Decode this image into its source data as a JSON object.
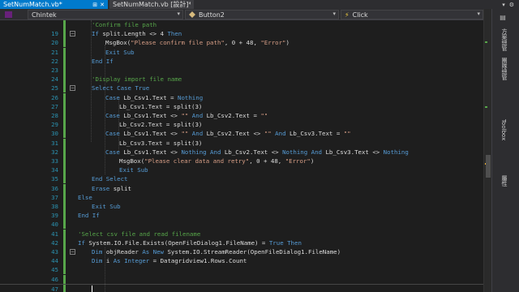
{
  "tabs": [
    {
      "label": "SetNumMatch.vb*",
      "pin": "⊞",
      "close": "✕",
      "active": true
    },
    {
      "label": "SetNumMatch.vb [設計]*",
      "active": false
    }
  ],
  "window_tools": [
    "▾",
    "⚙"
  ],
  "nav": {
    "project": "Chintek",
    "object": "Button2",
    "event": "Click"
  },
  "side_panel": {
    "tabs": [
      "方案總管",
      "團隊總管",
      "Toolbox",
      "屬性"
    ]
  },
  "code_lines": [
    {
      "n": "",
      "indent": 3,
      "parts": [
        [
          "c",
          "'Confirm file path"
        ]
      ]
    },
    {
      "n": "19",
      "indent": 3,
      "parts": [
        [
          "k",
          "If "
        ],
        [
          "t",
          "split.Length <> 4 "
        ],
        [
          "k",
          "Then"
        ]
      ]
    },
    {
      "n": "20",
      "indent": 4,
      "parts": [
        [
          "t",
          "MsgBox("
        ],
        [
          "s",
          "\"Please confirm file path\""
        ],
        [
          "t",
          ", 0 + 48, "
        ],
        [
          "s",
          "\"Error\""
        ],
        [
          "t",
          ")"
        ]
      ]
    },
    {
      "n": "21",
      "indent": 4,
      "parts": [
        [
          "k",
          "Exit Sub"
        ]
      ]
    },
    {
      "n": "22",
      "indent": 3,
      "parts": [
        [
          "k",
          "End If"
        ]
      ]
    },
    {
      "n": "23",
      "indent": 0,
      "parts": []
    },
    {
      "n": "24",
      "indent": 3,
      "parts": [
        [
          "c",
          "'Display import file name"
        ]
      ]
    },
    {
      "n": "25",
      "indent": 3,
      "parts": [
        [
          "k",
          "Select Case True"
        ]
      ]
    },
    {
      "n": "26",
      "indent": 4,
      "parts": [
        [
          "k",
          "Case "
        ],
        [
          "t",
          "Lb_Csv1.Text = "
        ],
        [
          "k",
          "Nothing"
        ]
      ]
    },
    {
      "n": "27",
      "indent": 5,
      "parts": [
        [
          "t",
          "Lb_Csv1.Text = split(3)"
        ]
      ]
    },
    {
      "n": "28",
      "indent": 4,
      "parts": [
        [
          "k",
          "Case "
        ],
        [
          "t",
          "Lb_Csv1.Text <> "
        ],
        [
          "s",
          "\"\""
        ],
        [
          "k",
          " And "
        ],
        [
          "t",
          "Lb_Csv2.Text = "
        ],
        [
          "s",
          "\"\""
        ]
      ]
    },
    {
      "n": "29",
      "indent": 5,
      "parts": [
        [
          "t",
          "Lb_Csv2.Text = split(3)"
        ]
      ]
    },
    {
      "n": "30",
      "indent": 4,
      "parts": [
        [
          "k",
          "Case "
        ],
        [
          "t",
          "Lb_Csv1.Text <> "
        ],
        [
          "s",
          "\"\""
        ],
        [
          "k",
          " And "
        ],
        [
          "t",
          "Lb_Csv2.Text <> "
        ],
        [
          "s",
          "\"\""
        ],
        [
          "k",
          " And "
        ],
        [
          "t",
          "Lb_Csv3.Text = "
        ],
        [
          "s",
          "\"\""
        ]
      ]
    },
    {
      "n": "31",
      "indent": 5,
      "parts": [
        [
          "t",
          "Lb_Csv3.Text = split(3)"
        ]
      ]
    },
    {
      "n": "32",
      "indent": 4,
      "parts": [
        [
          "k",
          "Case "
        ],
        [
          "t",
          "Lb_Csv1.Text <> "
        ],
        [
          "k",
          "Nothing And "
        ],
        [
          "t",
          "Lb_Csv2.Text <> "
        ],
        [
          "k",
          "Nothing And "
        ],
        [
          "t",
          "Lb_Csv3.Text <> "
        ],
        [
          "k",
          "Nothing"
        ]
      ]
    },
    {
      "n": "33",
      "indent": 5,
      "parts": [
        [
          "t",
          "MsgBox("
        ],
        [
          "s",
          "\"Please clear data and retry\""
        ],
        [
          "t",
          ", 0 + 48, "
        ],
        [
          "s",
          "\"Error\""
        ],
        [
          "t",
          ")"
        ]
      ]
    },
    {
      "n": "34",
      "indent": 5,
      "parts": [
        [
          "k",
          "Exit Sub"
        ]
      ]
    },
    {
      "n": "35",
      "indent": 3,
      "parts": [
        [
          "k",
          "End Select"
        ]
      ]
    },
    {
      "n": "36",
      "indent": 3,
      "parts": [
        [
          "k",
          "Erase "
        ],
        [
          "t",
          "split"
        ]
      ]
    },
    {
      "n": "37",
      "indent": 2,
      "parts": [
        [
          "k",
          "Else"
        ]
      ]
    },
    {
      "n": "38",
      "indent": 3,
      "parts": [
        [
          "k",
          "Exit Sub"
        ]
      ]
    },
    {
      "n": "39",
      "indent": 2,
      "parts": [
        [
          "k",
          "End If"
        ]
      ]
    },
    {
      "n": "40",
      "indent": 0,
      "parts": []
    },
    {
      "n": "41",
      "indent": 2,
      "parts": [
        [
          "c",
          "'Select csv file and read filename"
        ]
      ]
    },
    {
      "n": "42",
      "indent": 2,
      "parts": [
        [
          "k",
          "If "
        ],
        [
          "t",
          "System.IO.File.Exists(OpenFileDialog1.FileName) = "
        ],
        [
          "k",
          "True Then"
        ]
      ]
    },
    {
      "n": "43",
      "indent": 3,
      "parts": [
        [
          "k",
          "Dim "
        ],
        [
          "t",
          "objReader "
        ],
        [
          "k",
          "As New "
        ],
        [
          "t",
          "System.IO.StreamReader(OpenFileDialog1.FileName)"
        ]
      ]
    },
    {
      "n": "44",
      "indent": 3,
      "parts": [
        [
          "k",
          "Dim "
        ],
        [
          "t",
          "i "
        ],
        [
          "k",
          "As Integer "
        ],
        [
          "t",
          "= Datagridview1.Rows.Count"
        ]
      ]
    },
    {
      "n": "45",
      "indent": 3,
      "parts": [
        [
          "t",
          ""
        ]
      ]
    },
    {
      "n": "46",
      "indent": 2,
      "parts": []
    },
    {
      "n": "47",
      "indent": 2,
      "parts": []
    }
  ],
  "colors": {
    "keyword": "#569cd6",
    "string": "#d69d85",
    "comment": "#57a64a",
    "text": "#dcdcdc",
    "line_number": "#2b91af",
    "accent": "#007acc"
  }
}
